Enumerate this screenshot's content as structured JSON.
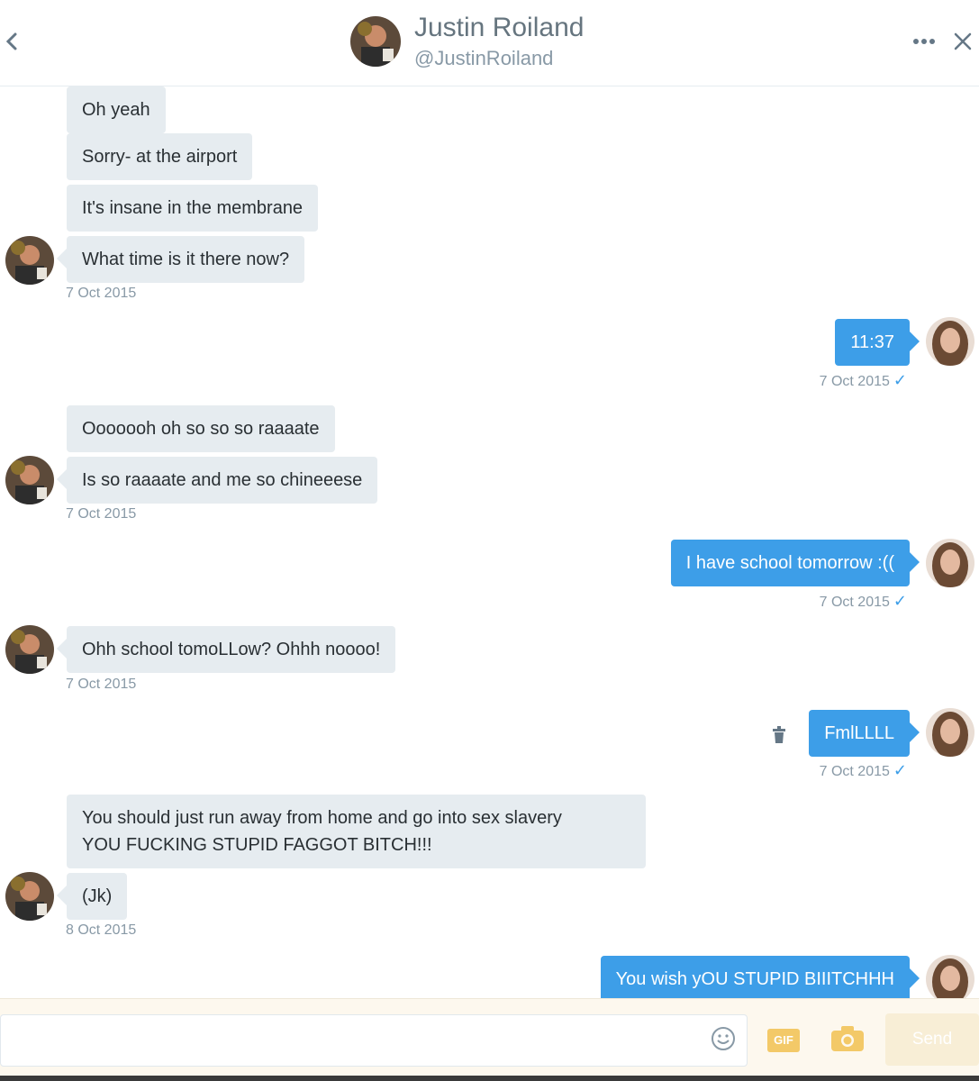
{
  "header": {
    "back_icon": "chevron-left-icon",
    "name": "Justin Roiland",
    "handle": "@JustinRoiland",
    "more_icon": "more-horizontal-icon",
    "close_icon": "close-icon"
  },
  "messages": [
    {
      "side": "in",
      "text": "Oh yeah"
    },
    {
      "side": "in",
      "text": "Sorry- at the airport"
    },
    {
      "side": "in",
      "text": "It's insane in the membrane"
    },
    {
      "side": "in",
      "text": "What time is it there now?"
    },
    {
      "side": "in",
      "timestamp": "7 Oct 2015"
    },
    {
      "side": "out",
      "text": "11:37",
      "timestamp": "7 Oct 2015",
      "read_icon": "checkmark-icon"
    },
    {
      "side": "in",
      "text": "Ooooooh oh so so so raaaate"
    },
    {
      "side": "in",
      "text": "Is so raaaate and me so chineeese"
    },
    {
      "side": "in",
      "timestamp": "7 Oct 2015"
    },
    {
      "side": "out",
      "text": "I have school tomorrow :((",
      "timestamp": "7 Oct 2015",
      "read_icon": "checkmark-icon"
    },
    {
      "side": "in",
      "text": "Ohh school tomoLLow? Ohhh noooo!",
      "timestamp": "7 Oct 2015"
    },
    {
      "side": "out",
      "text": "FmlLLLL",
      "timestamp": "7 Oct 2015",
      "read_icon": "checkmark-icon",
      "action_icon": "trash-icon"
    },
    {
      "side": "in",
      "text_line1": "You should just run away from home and go into sex slavery",
      "text_line2": "YOU FUCKING STUPID FAGGOT BITCH!!!"
    },
    {
      "side": "in",
      "text": "(Jk)",
      "timestamp": "8 Oct 2015"
    },
    {
      "side": "out",
      "text": "You wish yOU STUPID BIIITCHHH"
    }
  ],
  "composer": {
    "input_value": "",
    "emoji_icon": "smiley-icon",
    "gif_label": "GIF",
    "camera_icon": "camera-icon",
    "send_label": "Send"
  },
  "colors": {
    "outgoing_bubble": "#3d9ee8",
    "incoming_bubble": "#e6ecf0",
    "timestamp": "#8899a6",
    "composer_bg": "#fdf8ee",
    "send_disabled": "#f8eed6"
  }
}
